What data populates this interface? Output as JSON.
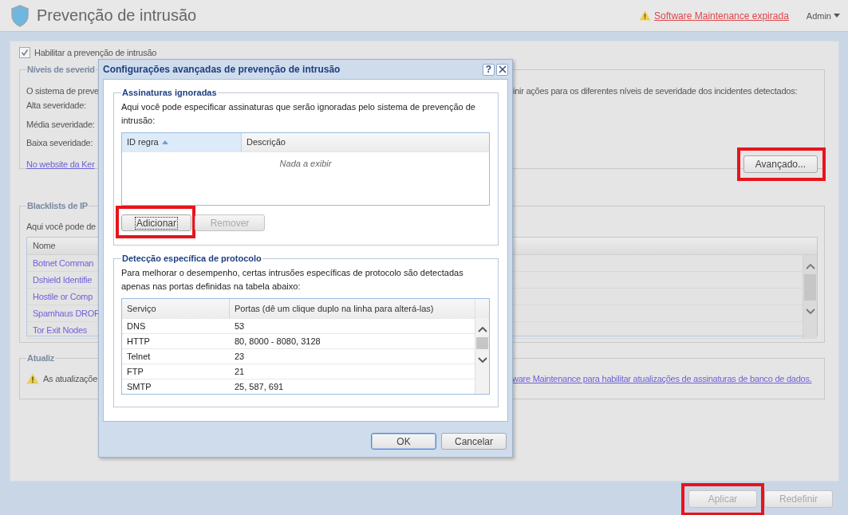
{
  "header": {
    "title": "Prevenção de intrusão",
    "warning_link": "Software Maintenance expirada",
    "user": "Admin"
  },
  "main": {
    "enable": {
      "label": "Habilitar a prevenção de intrusão",
      "checked": true
    },
    "severity": {
      "legend": "Níveis de severid",
      "intro_left": "O sistema de preve",
      "intro_right": "inir ações para os diferentes níveis de severidade dos incidentes detectados:",
      "labels": [
        "Alta severidade:",
        "Média severidade:",
        "Baixa severidade:"
      ],
      "link": "No website da Ker",
      "advanced_button": {
        "label": "Avançado...",
        "highlighted": true
      }
    },
    "blacklists": {
      "legend": "Blacklists de IP",
      "intro": "Aqui você pode de",
      "column": "Nome",
      "rows": [
        "Botnet Comman",
        "Dshield Identifie",
        "Hostile or Comp",
        "Spamhaus DROP",
        "Tor Exit Nodes"
      ]
    },
    "updates": {
      "legend": "Atualiz",
      "text": "As atualizaçõe",
      "link": "ware Maintenance para habilitar atualizações de assinaturas de banco de dados."
    },
    "footer_buttons": [
      {
        "label": "Aplicar",
        "disabled": true,
        "highlighted": true
      },
      {
        "label": "Redefinir",
        "disabled": true,
        "highlighted": false
      }
    ]
  },
  "dialog": {
    "title": "Configurações avançadas de prevenção de intrusão",
    "help": "?",
    "ignored": {
      "legend": "Assinaturas ignoradas",
      "text": "Aqui você pode especificar assinaturas que serão ignoradas pelo sistema de prevenção de intrusão:",
      "columns": [
        {
          "label": "ID regra",
          "sorted": true
        },
        {
          "label": "Descrição",
          "sorted": false
        }
      ],
      "empty": "Nada a exibir",
      "buttons": [
        {
          "label": "Adicionar",
          "disabled": false,
          "highlighted": true,
          "focused": true
        },
        {
          "label": "Remover",
          "disabled": true,
          "highlighted": false,
          "focused": false
        }
      ]
    },
    "protocol": {
      "legend": "Detecção específica de protocolo",
      "text": "Para melhorar o desempenho, certas intrusões específicas de protocolo são detectadas apenas nas portas definidas na tabela abaixo:",
      "columns": [
        "Serviço",
        "Portas (dê um clique duplo na linha para alterá-las)"
      ],
      "rows": [
        {
          "service": "DNS",
          "ports": "53"
        },
        {
          "service": "HTTP",
          "ports": "80, 8000 - 8080, 3128"
        },
        {
          "service": "Telnet",
          "ports": "23"
        },
        {
          "service": "FTP",
          "ports": "21"
        },
        {
          "service": "SMTP",
          "ports": "25, 587, 691"
        }
      ]
    },
    "buttons": [
      {
        "label": "OK",
        "default": true
      },
      {
        "label": "Cancelar",
        "default": false
      }
    ]
  }
}
